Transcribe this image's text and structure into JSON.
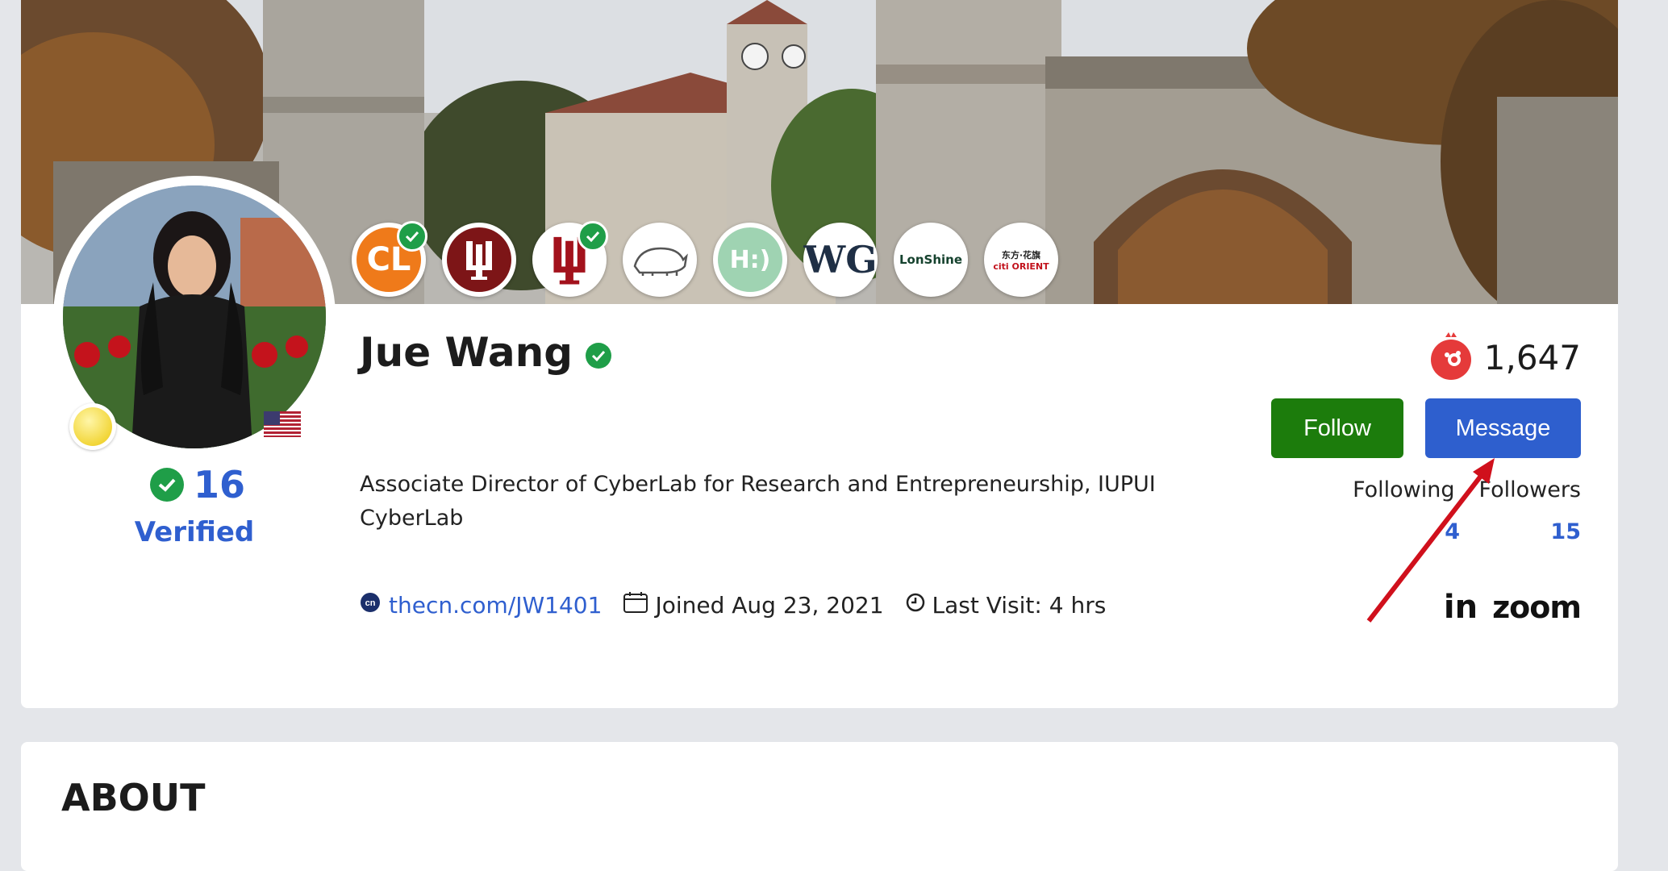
{
  "profile": {
    "name": "Jue Wang",
    "headline_line1": "Associate Director of CyberLab for Research and Entrepreneurship, IUPUI",
    "headline_line2": "CyberLab",
    "verified_count": "16",
    "verified_label": "Verified",
    "profile_link": "thecn.com/JW1401",
    "joined": "Joined Aug 23, 2021",
    "last_visit": "Last Visit: 4 hrs",
    "points": "1,647"
  },
  "badges": [
    {
      "label": "CL",
      "verified": true
    },
    {
      "label": "IU",
      "verified": false
    },
    {
      "label": "IU",
      "verified": true
    },
    {
      "label": "rhino",
      "verified": false
    },
    {
      "label": "HiLink Edu",
      "verified": false
    },
    {
      "label": "WG",
      "verified": false
    },
    {
      "label": "LonShine",
      "verified": false
    },
    {
      "label": "citi 东方·花旗 ORIENT",
      "verified": false
    }
  ],
  "actions": {
    "follow_label": "Follow",
    "message_label": "Message"
  },
  "stats": {
    "following_label": "Following",
    "followers_label": "Followers",
    "following_count": "4",
    "followers_count": "15"
  },
  "socials": {
    "linkedin_label": "in",
    "zoom_label": "zoom"
  },
  "sections": {
    "about_title": "ABOUT"
  },
  "colors": {
    "accent_blue": "#2e5fce",
    "follow_green": "#1c7c0c",
    "verified_green": "#1f9e48",
    "annotation_red": "#d0101c"
  }
}
